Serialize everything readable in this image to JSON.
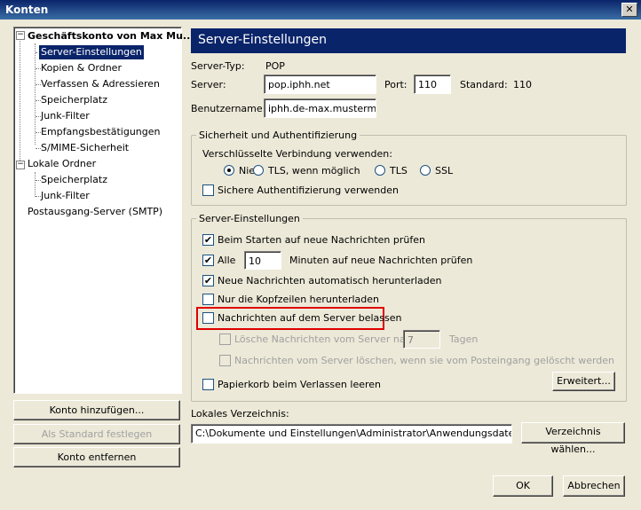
{
  "window": {
    "title": "Konten",
    "close_glyph": "✕"
  },
  "tree": {
    "items": [
      {
        "label": "Geschäftskonto von Max Mu...",
        "bold": true
      },
      {
        "label": "Server-Einstellungen",
        "selected": true
      },
      {
        "label": "Kopien & Ordner"
      },
      {
        "label": "Verfassen & Adressieren"
      },
      {
        "label": "Speicherplatz"
      },
      {
        "label": "Junk-Filter"
      },
      {
        "label": "Empfangsbestätigungen"
      },
      {
        "label": "S/MIME-Sicherheit"
      },
      {
        "label": "Lokale Ordner"
      },
      {
        "label": "Speicherplatz"
      },
      {
        "label": "Junk-Filter"
      },
      {
        "label": "Postausgang-Server (SMTP)"
      }
    ],
    "expand_glyph": "−"
  },
  "left_buttons": {
    "add_account": "Konto hinzufügen...",
    "set_default": "Als Standard festlegen",
    "remove_account": "Konto entfernen"
  },
  "panel": {
    "header": "Server-Einstellungen",
    "server_type_label": "Server-Typ:",
    "server_type_value": "POP",
    "server_label": "Server:",
    "server_value": "pop.iphh.net",
    "port_label": "Port:",
    "port_value": "110",
    "default_label": "Standard:",
    "default_value": "110",
    "username_label": "Benutzername:",
    "username_value": "iphh.de-max.musterman"
  },
  "security_group": {
    "title": "Sicherheit und Authentifizierung",
    "encrypted_label": "Verschlüsselte Verbindung verwenden:",
    "radios": [
      {
        "label": "Nie",
        "checked": true
      },
      {
        "label": "TLS, wenn möglich",
        "checked": false
      },
      {
        "label": "TLS",
        "checked": false
      },
      {
        "label": "SSL",
        "checked": false
      }
    ],
    "secure_auth": {
      "label": "Sichere Authentifizierung verwenden",
      "checked": false
    }
  },
  "server_group": {
    "title": "Server-Einstellungen",
    "check_on_start": {
      "label": "Beim Starten auf neue Nachrichten prüfen",
      "checked": true
    },
    "check_every": {
      "label": "Alle",
      "checked": true
    },
    "minutes_value": "10",
    "minutes_label": "Minuten auf neue Nachrichten prüfen",
    "auto_download": {
      "label": "Neue Nachrichten automatisch herunterladen",
      "checked": true
    },
    "headers_only": {
      "label": "Nur die Kopfzeilen herunterladen",
      "checked": false
    },
    "leave_on_server": {
      "label": "Nachrichten auf dem Server belassen",
      "checked": false
    },
    "delete_after": {
      "label": "Lösche Nachrichten vom Server nach",
      "checked": false
    },
    "days_value": "7",
    "days_label": "Tagen",
    "delete_when_deleted": {
      "label": "Nachrichten vom Server löschen, wenn sie vom Posteingang gelöscht werden",
      "checked": false
    },
    "empty_trash": {
      "label": "Papierkorb beim Verlassen leeren",
      "checked": false
    },
    "advanced_button": "Erweitert..."
  },
  "local_dir": {
    "label": "Lokales Verzeichnis:",
    "value": "C:\\Dokumente und Einstellungen\\Administrator\\Anwendungsdaten\\Thunde",
    "choose_button": "Verzeichnis wählen..."
  },
  "dialog_buttons": {
    "ok": "OK",
    "cancel": "Abbrechen"
  },
  "check_glyph": "✔",
  "colors": {
    "selection": "#0a246a",
    "highlight_box": "#e00000",
    "dialog_bg": "#ece9d8"
  }
}
